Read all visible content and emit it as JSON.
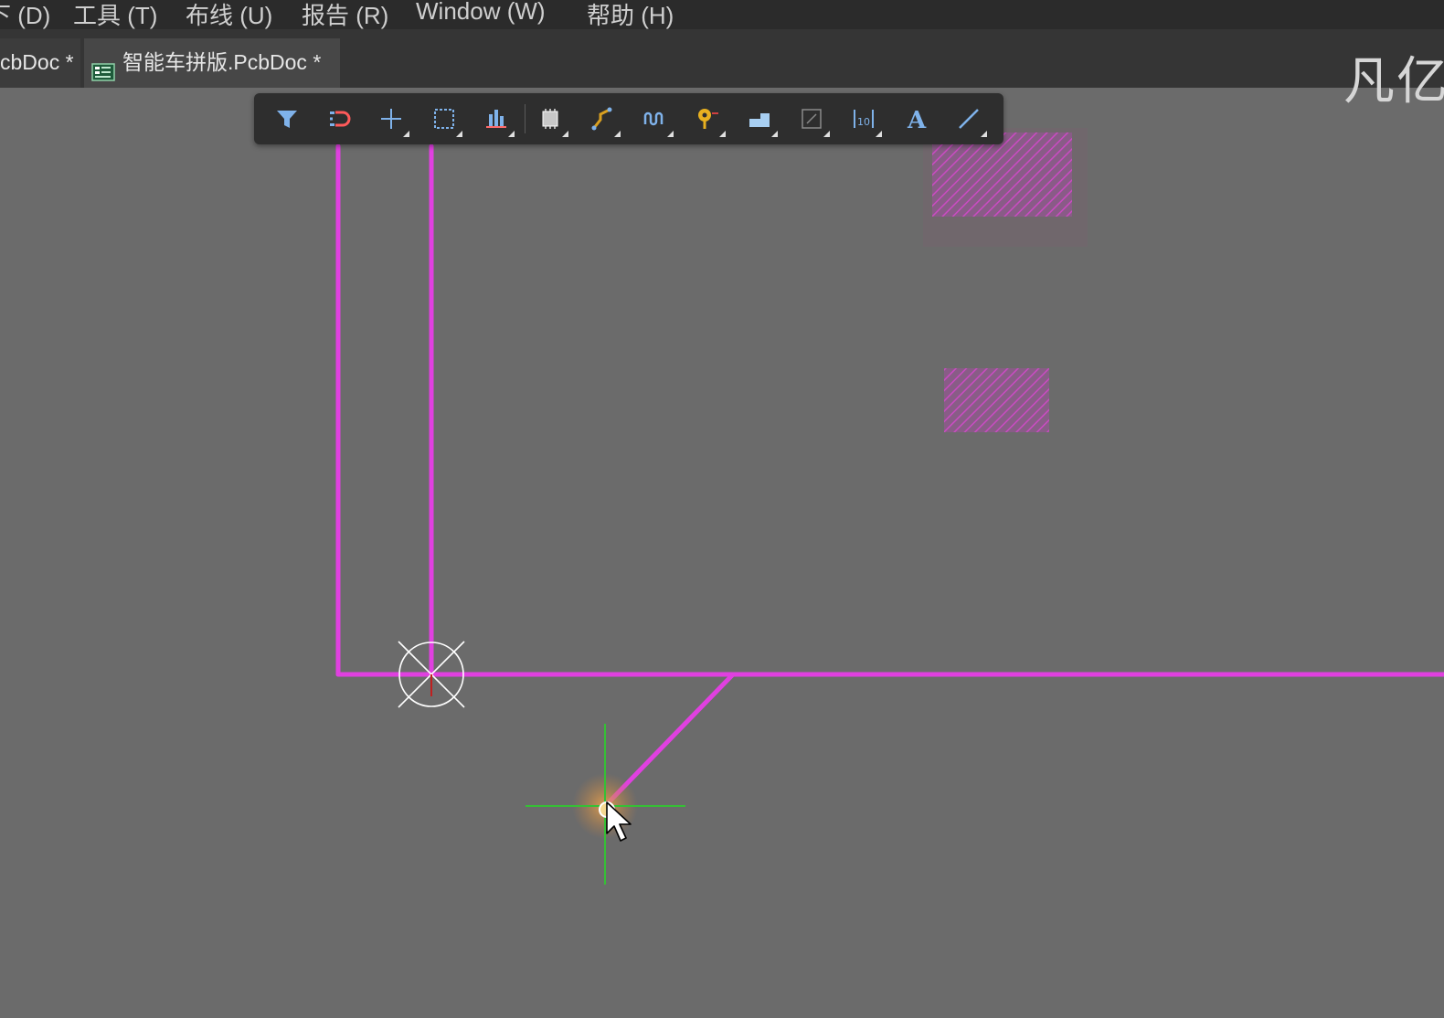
{
  "menu": {
    "items": [
      "下 (D)",
      "工具 (T)",
      "布线 (U)",
      "报告 (R)",
      "Window (W)",
      "帮助 (H)"
    ]
  },
  "tabs": [
    {
      "label": "cbDoc *",
      "active": false
    },
    {
      "label": "智能车拼版.PcbDoc *",
      "active": true,
      "icon": "pcb-document-icon"
    }
  ],
  "watermark": "凡亿",
  "toolbar": {
    "tools": [
      {
        "name": "filter-icon",
        "has_dropdown": false
      },
      {
        "name": "snap-magnet-icon",
        "has_dropdown": false
      },
      {
        "name": "crosshair-icon",
        "has_dropdown": true
      },
      {
        "name": "select-rectangle-icon",
        "has_dropdown": true
      },
      {
        "name": "align-icon",
        "has_dropdown": true
      },
      {
        "name": "component-icon",
        "has_dropdown": true
      },
      {
        "name": "route-track-icon",
        "has_dropdown": true
      },
      {
        "name": "length-tuning-icon",
        "has_dropdown": true
      },
      {
        "name": "via-pin-icon",
        "has_dropdown": true
      },
      {
        "name": "polygon-fill-icon",
        "has_dropdown": true
      },
      {
        "name": "keepout-icon",
        "has_dropdown": true
      },
      {
        "name": "dimension-icon",
        "has_dropdown": true
      },
      {
        "name": "text-string-icon",
        "has_dropdown": false
      },
      {
        "name": "line-icon",
        "has_dropdown": true
      }
    ]
  },
  "colors": {
    "canvas_bg": "#6b6b6b",
    "track": "#e040e0",
    "pad_hatch": "#d040c8",
    "cursor_cross": "#35c035",
    "menubar_bg": "#2b2b2b",
    "toolbar_bg": "#2e2e2e"
  }
}
